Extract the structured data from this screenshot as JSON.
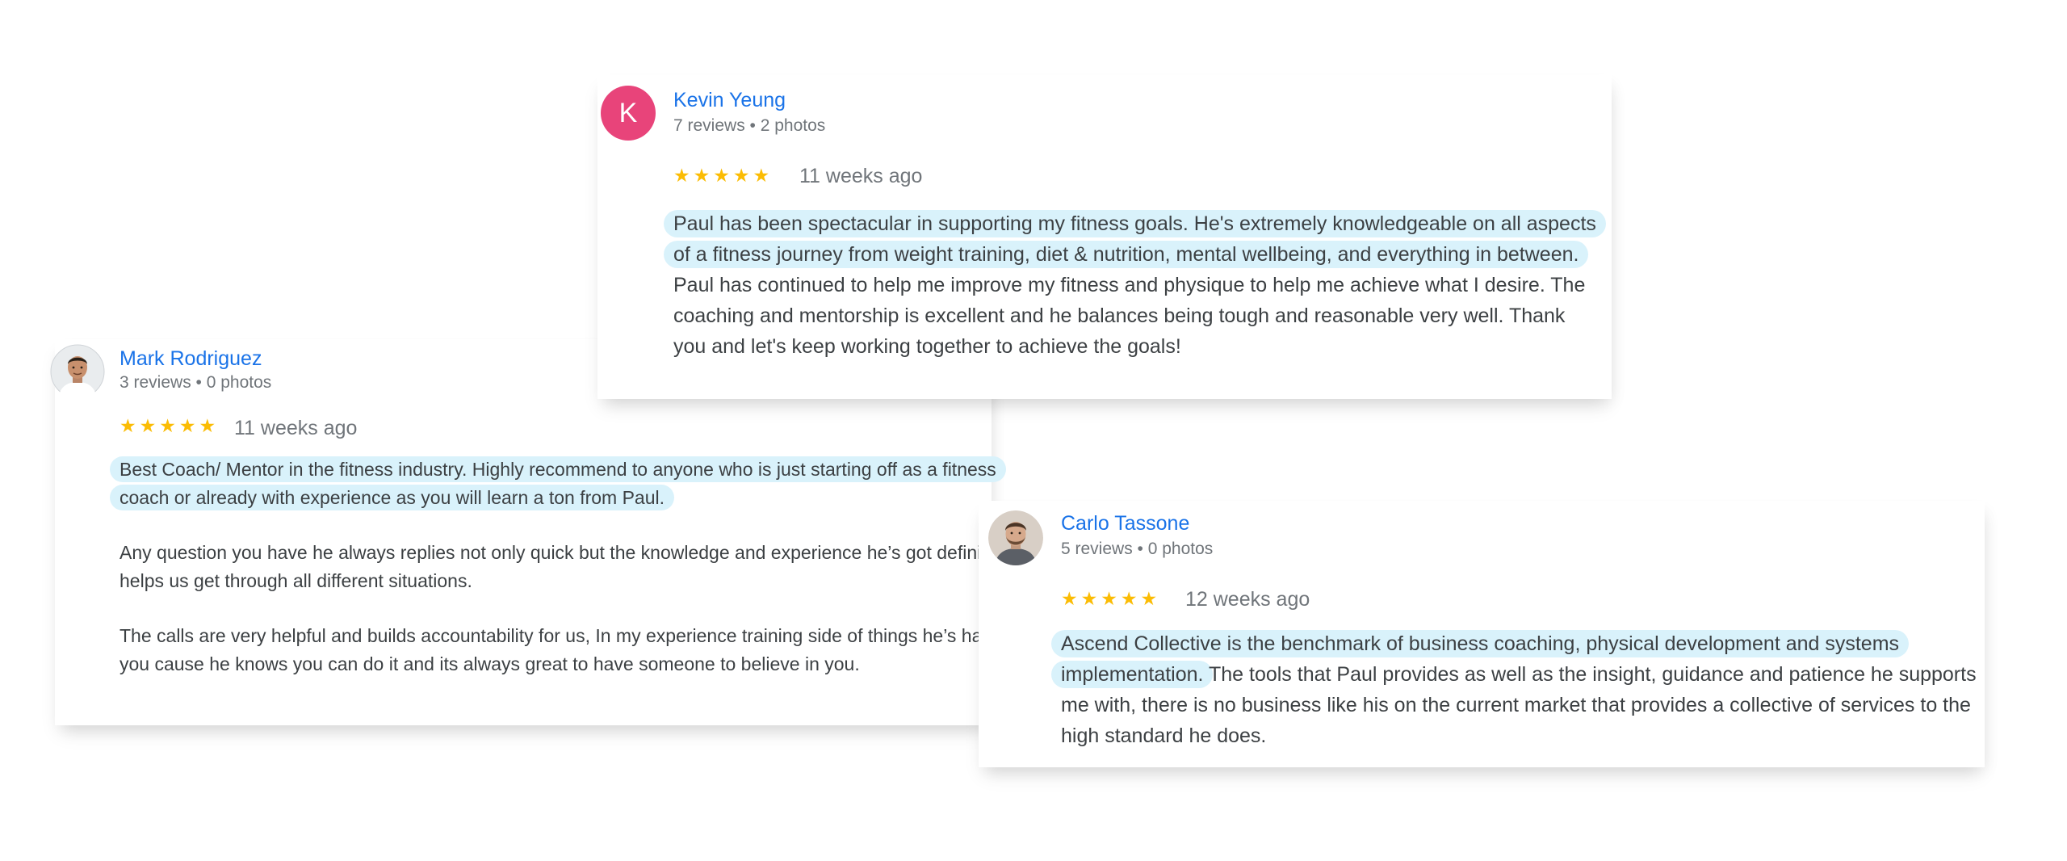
{
  "colors": {
    "name_link": "#1a73e8",
    "star": "#fbbc04",
    "highlight": "#d9f2fb",
    "avatar_k_bg": "#e8447a"
  },
  "reviews": {
    "kevin": {
      "avatar_letter": "K",
      "name": "Kevin Yeung",
      "meta": "7 reviews • 2 photos",
      "stars": "★★★★★",
      "rating": 5,
      "date": "11 weeks ago",
      "highlight": "Paul has been spectacular in supporting my fitness goals. He's extremely knowledgeable on all aspects of a fitness journey from weight training, diet & nutrition, mental wellbeing, and everything in between.",
      "text": " Paul has continued to help me improve my fitness and physique to help me achieve what I desire. The coaching and mentorship is excellent and he balances being tough and reasonable very well. Thank you and let's keep working together to achieve the goals!"
    },
    "mark": {
      "avatar_icon": "man-portrait-icon",
      "name": "Mark Rodriguez",
      "meta": "3 reviews • 0 photos",
      "stars": "★★★★★",
      "rating": 5,
      "date": "11 weeks ago",
      "highlight": "Best Coach/ Mentor in the fitness industry. Highly recommend to anyone who is just starting off as a fitness coach or already with experience as you will learn a ton from Paul.",
      "paragraph2": "Any question you have he always replies not only quick but the knowledge and experience he’s got definitely helps us get through all different situations.",
      "paragraph3": "The calls are very helpful and builds accountability for us, In my experience training side of things he’s hard on you cause he knows you can do it and its always great to have someone to believe in you."
    },
    "carlo": {
      "avatar_icon": "man-portrait-icon",
      "name": "Carlo Tassone",
      "meta": "5 reviews • 0 photos",
      "stars": "★★★★★",
      "rating": 5,
      "date": "12 weeks ago",
      "highlight": "Ascend Collective is the benchmark of business coaching, physical development and systems implementation.",
      "text": " The tools that Paul provides as well as the insight, guidance and patience he supports me with, there is no business like his on the current market that provides a collective of services to the high standard he does."
    }
  }
}
